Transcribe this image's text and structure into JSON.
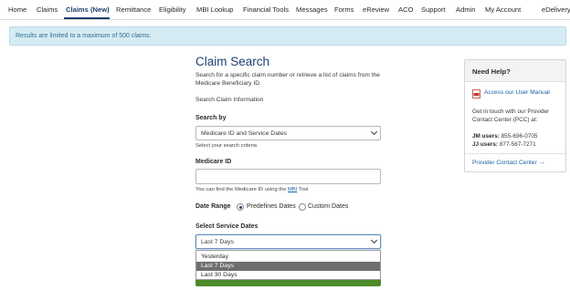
{
  "nav": {
    "items": [
      {
        "label": "Home"
      },
      {
        "label": "Claims"
      },
      {
        "label": "Claims (New)"
      },
      {
        "label": "Remittance"
      },
      {
        "label": "Eligibility"
      },
      {
        "label": "MBI Lookup"
      },
      {
        "label": "Financial Tools"
      },
      {
        "label": "Messages"
      },
      {
        "label": "Forms"
      },
      {
        "label": "eReview"
      },
      {
        "label": "ACO"
      },
      {
        "label": "Support"
      },
      {
        "label": "Admin"
      },
      {
        "label": "My Account"
      },
      {
        "label": "eDelivery"
      }
    ],
    "active": "Claims (New)"
  },
  "alert": {
    "text": "Results are limited to a maximum of 500 claims."
  },
  "form": {
    "title": "Claim Search",
    "description": "Search for a specific claim number or retrieve a list of claims from the Medicare Beneficiary ID.",
    "section_label": "Search Claim Information",
    "search_by": {
      "label": "Search by",
      "value": "Medicare ID and Service Dates",
      "hint": "Select your search criteria"
    },
    "medicare_id": {
      "label": "Medicare ID",
      "value": "",
      "hint_prefix": "You can find the Medicare ID using the",
      "hint_link": "MBI",
      "hint_suffix": "Tool"
    },
    "date_range": {
      "label": "Date Range",
      "options": [
        "Predefines Dates",
        "Custom Dates"
      ],
      "selected": "Predefines Dates"
    },
    "service_dates": {
      "label": "Select Service Dates",
      "value": "Last 7 Days",
      "options": [
        "Yesterday",
        "Last 7 Days",
        "Last 30 Days"
      ],
      "highlighted": "Last 7 Days"
    }
  },
  "help": {
    "title": "Need Help?",
    "manual_link": "Access our User Manual",
    "contact_text": "Get in touch with our Provider Contact Center (PCC) at:",
    "phones": [
      {
        "label": "JM users:",
        "number": "855-696-0705"
      },
      {
        "label": "JJ users:",
        "number": "877-567-7271"
      }
    ],
    "pcc_link": "Provider Contact Center →"
  },
  "colors": {
    "brand": "#1d3f6e",
    "alert_bg": "#d6ecf5",
    "alert_text": "#31708f",
    "submit_green": "#4d8a2a",
    "option_highlight": "#6e6e6e"
  }
}
